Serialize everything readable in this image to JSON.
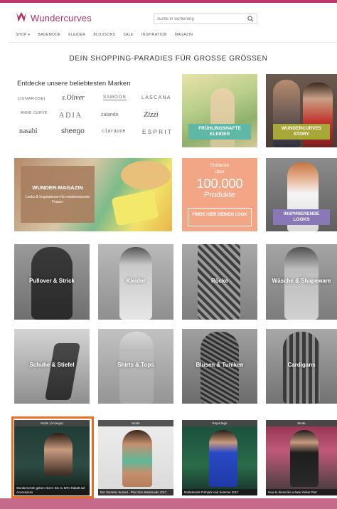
{
  "colors": {
    "brand": "#b33060",
    "accent_orange": "#ea6e22",
    "promo_salmon": "#f2a686",
    "teal_pill": "#5fb8a5",
    "olive_pill": "#a8a83a",
    "purple_pill": "#8978b8"
  },
  "header": {
    "logo_icon": "crown-w-icon",
    "logo_text": "Wundercurves",
    "search": {
      "placeholder": "suche in Sortierung",
      "icon": "search-icon"
    }
  },
  "nav": {
    "items": [
      "SHOP ▾",
      "BADEMODE",
      "KLEIDER",
      "BLOUSONS",
      "SALE",
      "INSPIRATION",
      "MAGAZIN"
    ]
  },
  "page_heading": "DEIN SHOPPING-PARADIES FÜR GROSSE GRÖSSEN",
  "brands": {
    "title": "Entdecke unsere beliebtesten Marken",
    "items": [
      "[JUNAROSE]",
      "s.Oliver",
      "SAMOON",
      "LASCANA",
      "ANNE CURVE",
      "ADIA",
      "zalando",
      "Zizzi",
      "nasabi",
      "sheego",
      "ciaraone",
      "ESPRIT"
    ]
  },
  "feature_tiles": {
    "spring_dresses": "FRÜHLINGSHAFTE KLEIDER",
    "story": "WUNDERCURVES STORY",
    "magazine_title": "WUNDER-MAGAZIN",
    "magazine_sub": "Looks & Inspirationen für modebewusste Frauen",
    "promo_line1": "Entdecke",
    "promo_line2": "über",
    "promo_number": "100.000",
    "promo_word": "Produkte",
    "promo_button": "FINDE HIER DEINEN LOOK",
    "inspiring_looks": "INSPIRIERENDE LOOKS"
  },
  "categories": [
    "Pullover & Strick",
    "Kleider",
    "Röcke",
    "Wäsche & Shapeware",
    "Schuhe & Stiefel",
    "Shirts & Tops",
    "Blusen & Tuniken",
    "Cardigans"
  ],
  "articles": [
    {
      "tag": "Mode (Anzeige)",
      "caption": "Wunderschön geben Akers: Bis zu 50% Rabatt auf Accessoires"
    },
    {
      "tag": "Mode",
      "caption": "Der Summer Sunset - Plus Size Bademode 2017"
    },
    {
      "tag": "Reportage",
      "caption": "Modetrends Frühjahr und Sommer 2017"
    },
    {
      "tag": "Mode",
      "caption": "How to dress like a New Yorker Part"
    }
  ]
}
